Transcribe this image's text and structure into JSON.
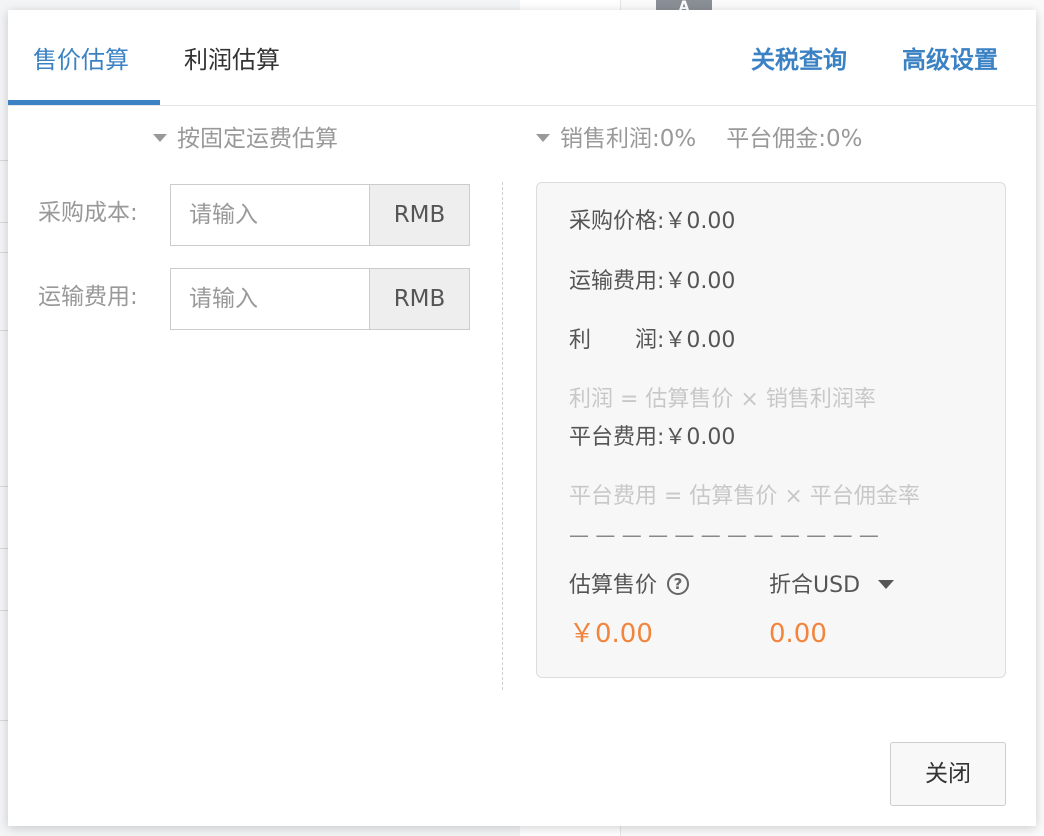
{
  "background": {
    "chip_text": "A"
  },
  "tabs": [
    {
      "label": "售价估算",
      "active": true
    },
    {
      "label": "利润估算",
      "active": false
    }
  ],
  "header_links": {
    "tariff": "关税查询",
    "advanced": "高级设置"
  },
  "left_section": {
    "title": "按固定运费估算",
    "fields": [
      {
        "label": "采购成本:",
        "placeholder": "请输入",
        "value": "",
        "unit": "RMB"
      },
      {
        "label": "运输费用:",
        "placeholder": "请输入",
        "value": "",
        "unit": "RMB"
      }
    ]
  },
  "right_section": {
    "profit_label": "销售利润:",
    "profit_value": "0%",
    "commission_label": "平台佣金:",
    "commission_value": "0%"
  },
  "results": {
    "purchase_price": "采购价格:￥0.00",
    "shipping": "运输费用:￥0.00",
    "profit": "利　　润:￥0.00",
    "profit_hint": "利润 = 估算售价 × 销售利润率",
    "platform_fee": "平台费用:￥0.00",
    "platform_fee_hint": "平台费用 = 估算售价 × 平台佣金率",
    "separator": "— — — — — — — — — — — —",
    "est_price_label": "估算售价",
    "help_symbol": "?",
    "convert_label": "折合USD",
    "est_price_value": "￥0.00",
    "convert_value": "0.00"
  },
  "footer": {
    "close_label": "关闭"
  },
  "colors": {
    "accent": "#3b82c4",
    "value": "#f2843c"
  }
}
